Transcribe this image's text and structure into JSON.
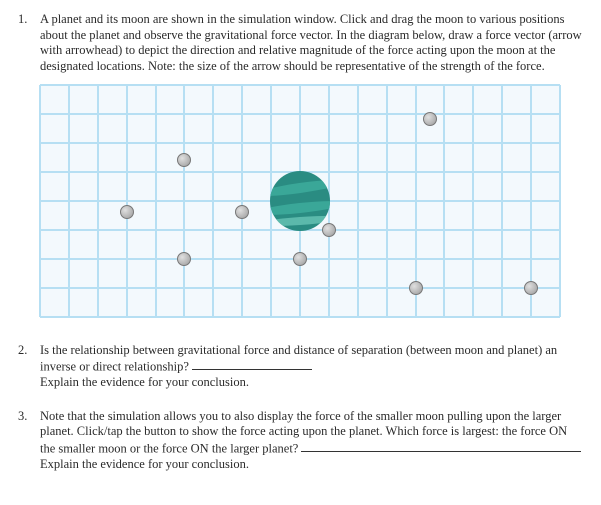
{
  "questions": [
    {
      "num": "1.",
      "text": "A planet and its moon are shown in the simulation window. Click and drag the moon to various positions about the planet and observe the gravitational force vector. In the diagram below, draw a force vector (arrow with arrowhead) to depict the direction and relative magnitude of the force acting upon the moon at the designated locations. Note: the size of the arrow should be representative of the strength of the force."
    },
    {
      "num": "2.",
      "text_a": "Is the relationship between gravitational force and distance of separation (between moon and planet) an inverse or direct relationship? ",
      "text_b": "Explain the evidence for your conclusion."
    },
    {
      "num": "3.",
      "text_a": "Note that the simulation allows you to also display the force of the smaller moon pulling upon the larger planet. Click/tap the button to show the force acting upon the planet. Which force is largest: the force ON the smaller moon or the force ON the larger planet? ",
      "text_b": "Explain the evidence for your conclusion."
    }
  ],
  "chart_data": {
    "type": "scatter",
    "title": "",
    "xlabel": "",
    "ylabel": "",
    "grid_cols": 18,
    "grid_rows": 8,
    "planet": {
      "col": 9,
      "row": 4
    },
    "moons": [
      {
        "col": 13.5,
        "row": 1.2
      },
      {
        "col": 5,
        "row": 2.6
      },
      {
        "col": 3,
        "row": 4.4
      },
      {
        "col": 7,
        "row": 4.4
      },
      {
        "col": 10,
        "row": 5
      },
      {
        "col": 5,
        "row": 6
      },
      {
        "col": 9,
        "row": 6
      },
      {
        "col": 13,
        "row": 7
      },
      {
        "col": 17,
        "row": 7
      }
    ]
  }
}
